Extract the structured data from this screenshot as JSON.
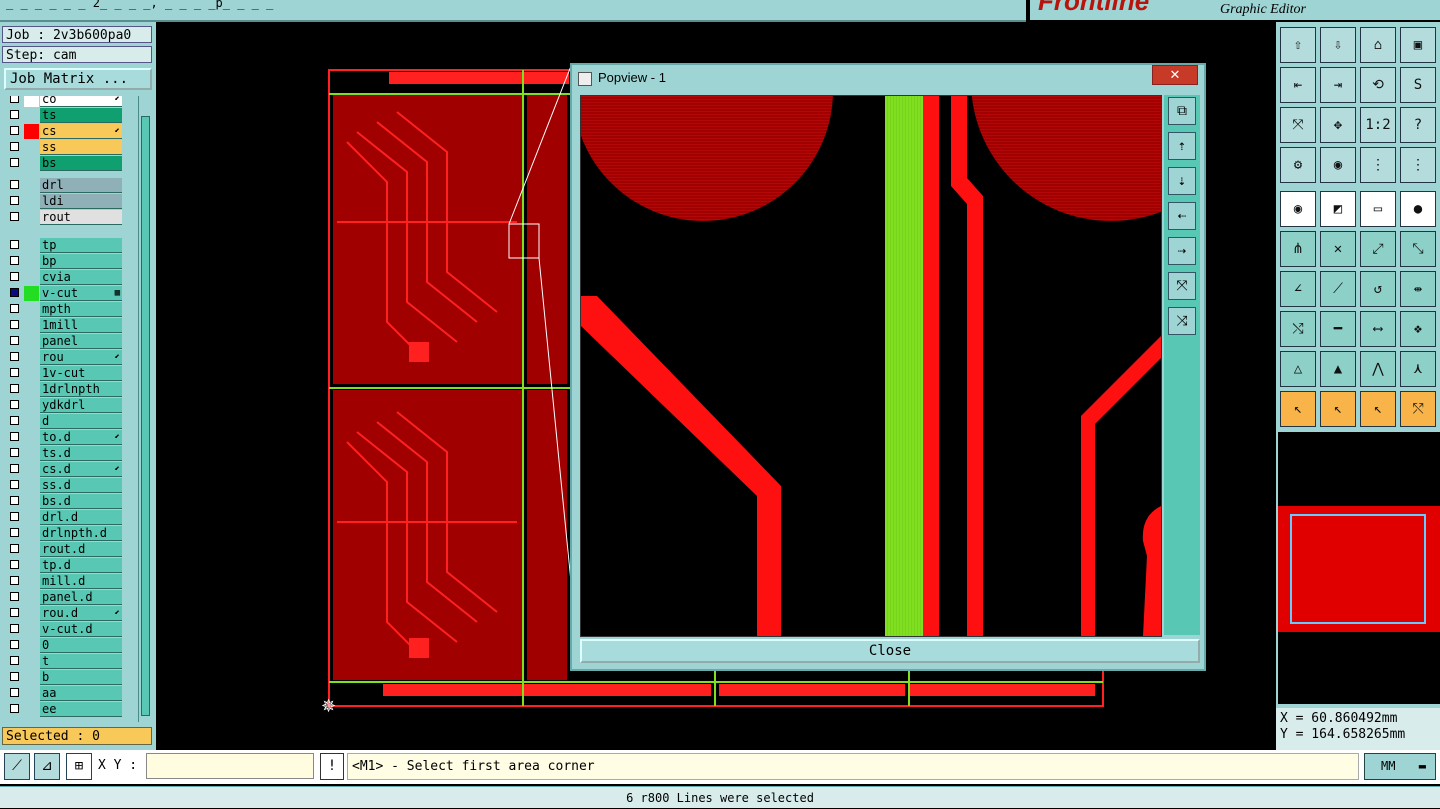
{
  "titlebar": {
    "text": "_ _ _ _ _ _ 2_ _ _ _, _ _ _ _p_ _ _ _"
  },
  "brand": {
    "logo": "Frontline",
    "subtitle": "Graphic Editor"
  },
  "job": {
    "job_line": "Job : 2v3b600pa0",
    "step_line": "Step: cam",
    "matrix_button": "Job Matrix ..."
  },
  "layers": [
    {
      "name": "co",
      "color": "#ffffff",
      "bg": "#ffffff",
      "mark": "⬋"
    },
    {
      "name": "ts",
      "color": "",
      "bg": "#10a070",
      "mark": ""
    },
    {
      "name": "cs",
      "color": "#ff0000",
      "bg": "#f8c858",
      "mark": "⬋"
    },
    {
      "name": "ss",
      "color": "",
      "bg": "#f8c858",
      "mark": ""
    },
    {
      "name": "bs",
      "color": "",
      "bg": "#10a070",
      "mark": ""
    },
    {
      "name": "drl",
      "color": "",
      "bg": "#90b0b8",
      "mark": ""
    },
    {
      "name": "ldi",
      "color": "",
      "bg": "#90b0b8",
      "mark": ""
    },
    {
      "name": "rout",
      "color": "",
      "bg": "#e0e0e0",
      "mark": ""
    },
    {
      "name": "tp",
      "color": "",
      "bg": "#58c8b4",
      "mark": ""
    },
    {
      "name": "bp",
      "color": "",
      "bg": "#58c8b4",
      "mark": ""
    },
    {
      "name": "cvia",
      "color": "",
      "bg": "#58c8b4",
      "mark": ""
    },
    {
      "name": "v-cut",
      "color": "#22dd22",
      "bg": "#58c8b4",
      "mark": "▦"
    },
    {
      "name": "mpth",
      "color": "",
      "bg": "#58c8b4",
      "mark": ""
    },
    {
      "name": "1mill",
      "color": "",
      "bg": "#58c8b4",
      "mark": ""
    },
    {
      "name": "panel",
      "color": "",
      "bg": "#58c8b4",
      "mark": ""
    },
    {
      "name": "rou",
      "color": "",
      "bg": "#58c8b4",
      "mark": "⬋"
    },
    {
      "name": "1v-cut",
      "color": "",
      "bg": "#58c8b4",
      "mark": ""
    },
    {
      "name": "1drlnpth",
      "color": "",
      "bg": "#58c8b4",
      "mark": ""
    },
    {
      "name": "ydkdrl",
      "color": "",
      "bg": "#58c8b4",
      "mark": ""
    },
    {
      "name": "d",
      "color": "",
      "bg": "#58c8b4",
      "mark": ""
    },
    {
      "name": "to.d",
      "color": "",
      "bg": "#58c8b4",
      "mark": "⬋"
    },
    {
      "name": "ts.d",
      "color": "",
      "bg": "#58c8b4",
      "mark": ""
    },
    {
      "name": "cs.d",
      "color": "",
      "bg": "#58c8b4",
      "mark": "⬋"
    },
    {
      "name": "ss.d",
      "color": "",
      "bg": "#58c8b4",
      "mark": ""
    },
    {
      "name": "bs.d",
      "color": "",
      "bg": "#58c8b4",
      "mark": ""
    },
    {
      "name": "drl.d",
      "color": "",
      "bg": "#58c8b4",
      "mark": ""
    },
    {
      "name": "drlnpth.d",
      "color": "",
      "bg": "#58c8b4",
      "mark": ""
    },
    {
      "name": "rout.d",
      "color": "",
      "bg": "#58c8b4",
      "mark": ""
    },
    {
      "name": "tp.d",
      "color": "",
      "bg": "#58c8b4",
      "mark": ""
    },
    {
      "name": "mill.d",
      "color": "",
      "bg": "#58c8b4",
      "mark": ""
    },
    {
      "name": "panel.d",
      "color": "",
      "bg": "#58c8b4",
      "mark": ""
    },
    {
      "name": "rou.d",
      "color": "",
      "bg": "#58c8b4",
      "mark": "⬋"
    },
    {
      "name": "v-cut.d",
      "color": "",
      "bg": "#58c8b4",
      "mark": ""
    },
    {
      "name": "0",
      "color": "",
      "bg": "#58c8b4",
      "mark": ""
    },
    {
      "name": "t",
      "color": "",
      "bg": "#58c8b4",
      "mark": ""
    },
    {
      "name": "b",
      "color": "",
      "bg": "#58c8b4",
      "mark": ""
    },
    {
      "name": "aa",
      "color": "",
      "bg": "#58c8b4",
      "mark": ""
    },
    {
      "name": "ee",
      "color": "",
      "bg": "#58c8b4",
      "mark": ""
    }
  ],
  "selected_text": "Selected : 0",
  "popview": {
    "title": "Popview - 1",
    "close_label": "Close",
    "x_label": "✕"
  },
  "coords": {
    "x": "X = 60.860492mm",
    "y": "Y = 164.658265mm"
  },
  "cmd": {
    "xy_label": "X Y :",
    "xy_value": "",
    "prompt": "<M1> - Select first area corner",
    "units": "MM"
  },
  "status": "6 r800 Lines were selected",
  "colors": {
    "panel": "#9ed4d4",
    "trace": "#ff0000",
    "vcut": "#80e020"
  }
}
